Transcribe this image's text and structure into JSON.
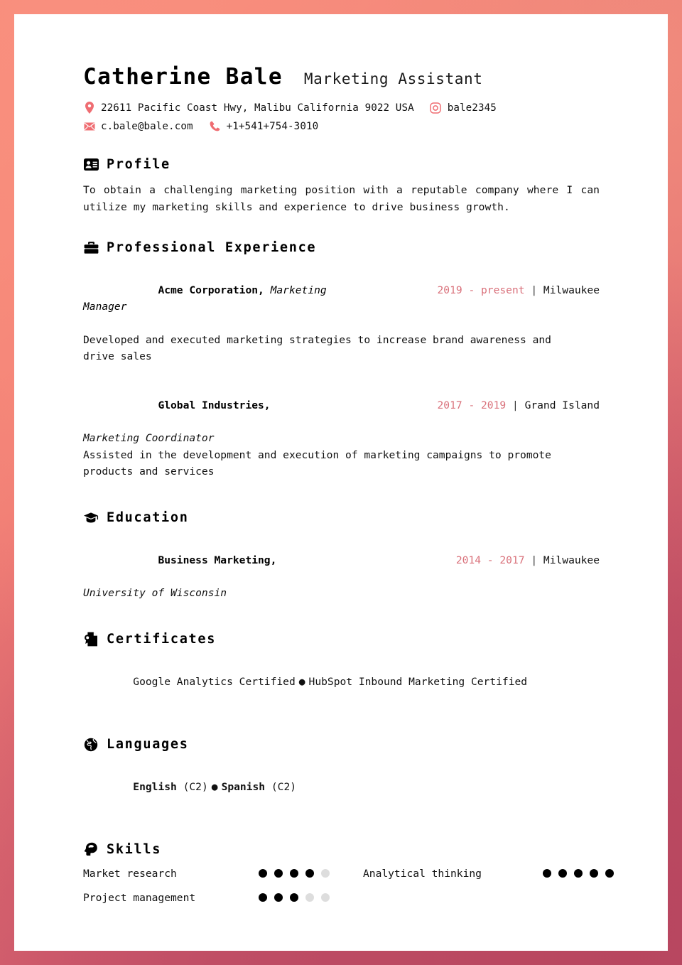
{
  "theme": {
    "accent": "#d9707a",
    "icon_accent": "#ef6d72",
    "page_bg": "#ffffff",
    "border": "#ef7b74"
  },
  "header": {
    "full_name": "Catherine Bale",
    "job_title": "Marketing Assistant",
    "contacts_row1": [
      {
        "icon": "location-pin-icon",
        "text": "22611 Pacific Coast Hwy, Malibu California 9022 USA"
      },
      {
        "icon": "instagram-icon",
        "text": "bale2345"
      }
    ],
    "contacts_row2": [
      {
        "icon": "envelope-icon",
        "text": "c.bale@bale.com"
      },
      {
        "icon": "phone-icon",
        "text": "+1+541+754-3010"
      }
    ]
  },
  "sections": {
    "profile": {
      "icon": "id-card-icon",
      "title": "Profile",
      "text": "To obtain a challenging marketing position with a reputable company where I can utilize my marketing skills and experience to drive business growth."
    },
    "experience": {
      "icon": "briefcase-icon",
      "title": "Professional Experience",
      "entries": [
        {
          "organization": "Acme Corporation,",
          "role": "Marketing Manager",
          "role_inline": true,
          "date": "2019 - present",
          "separator": "|",
          "location": "Milwaukee",
          "description": "Developed and executed marketing strategies to increase brand awareness and drive sales"
        },
        {
          "organization": "Global Industries,",
          "role": "Marketing Coordinator",
          "role_inline": false,
          "date": "2017 - 2019",
          "separator": "|",
          "location": "Grand Island",
          "description": "Assisted in the development and execution of marketing campaigns to promote products and services"
        }
      ]
    },
    "education": {
      "icon": "graduation-cap-icon",
      "title": "Education",
      "entries": [
        {
          "organization": "Business Marketing,",
          "role": "University of Wisconsin",
          "role_inline": false,
          "date": "2014 - 2017",
          "separator": "|",
          "location": "Milwaukee",
          "description": ""
        }
      ]
    },
    "certificates": {
      "icon": "certificate-icon",
      "title": "Certificates",
      "items": [
        "Google Analytics Certified",
        "HubSpot Inbound Marketing Certified"
      ],
      "separator": "●"
    },
    "languages": {
      "icon": "globe-icon",
      "title": "Languages",
      "items": [
        {
          "name": "English",
          "level": "(C2)"
        },
        {
          "name": "Spanish",
          "level": "(C2)"
        }
      ],
      "separator": "●"
    },
    "skills": {
      "icon": "head-brain-icon",
      "title": "Skills",
      "max_rating": 5,
      "items": [
        {
          "label": "Market research",
          "rating": 4
        },
        {
          "label": "Analytical thinking",
          "rating": 5
        },
        {
          "label": "Project management",
          "rating": 3
        }
      ]
    }
  }
}
